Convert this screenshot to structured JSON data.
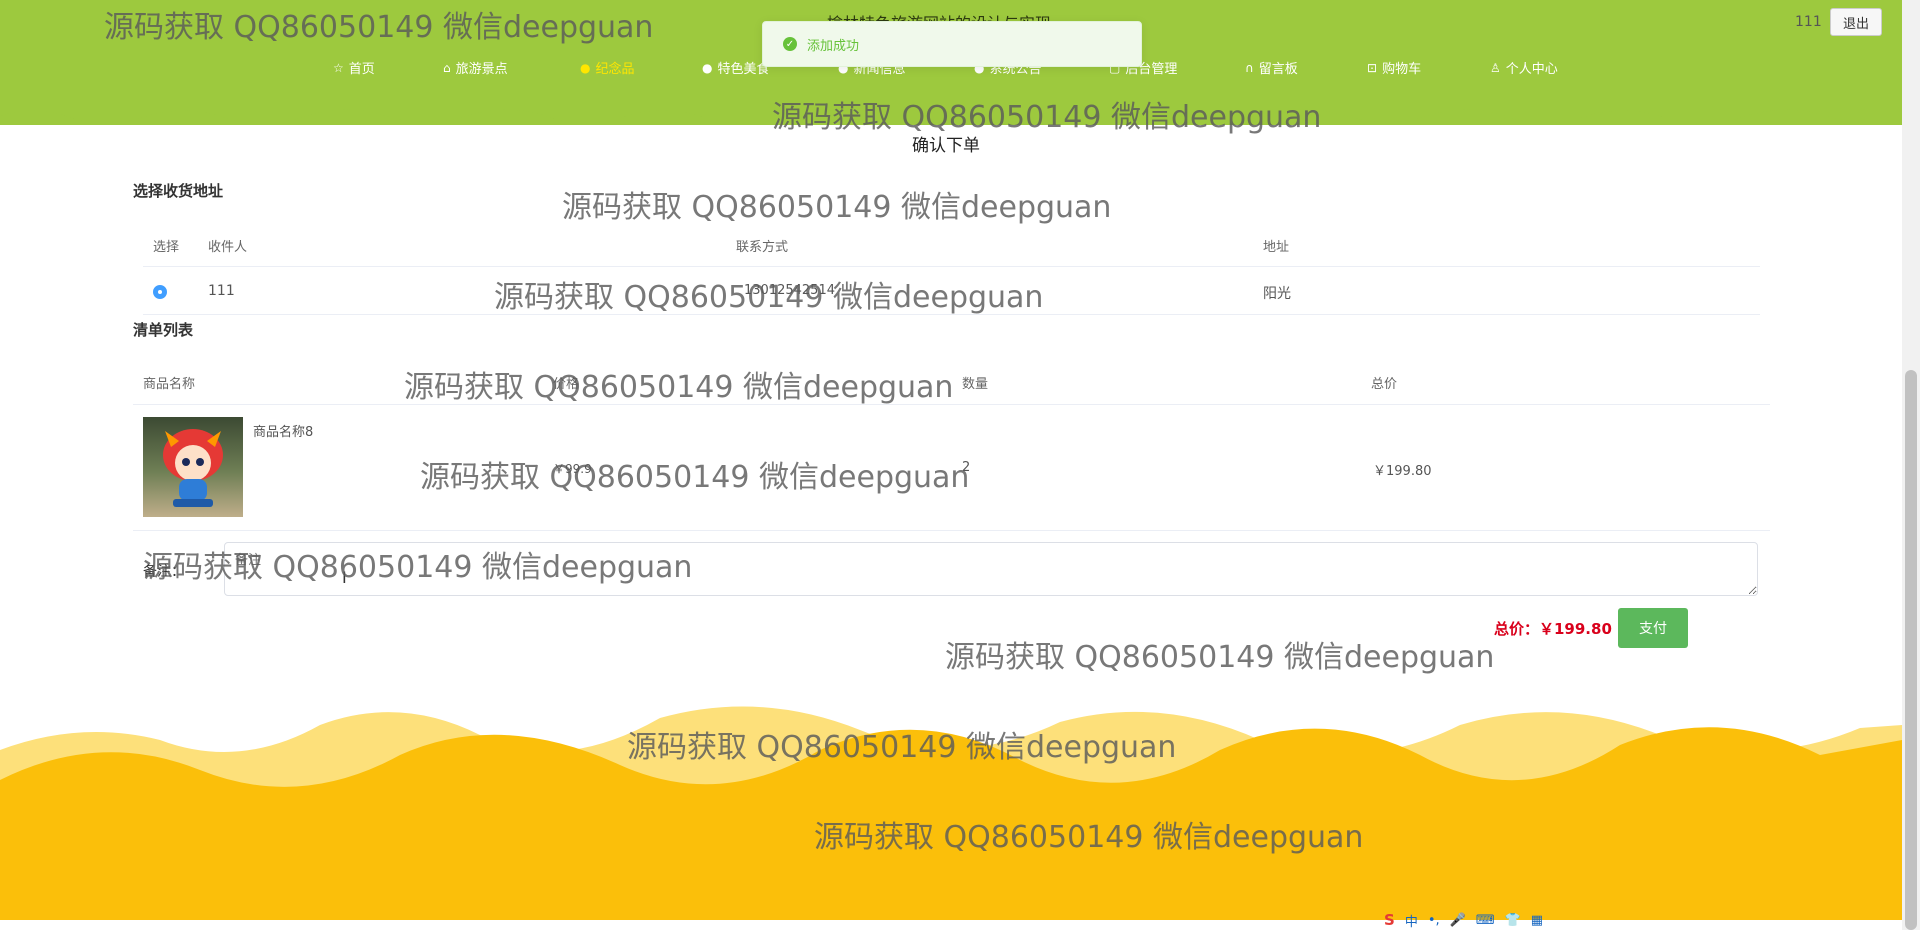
{
  "header": {
    "site_title": "榆林特色旅游网站的设计与实现",
    "user_name": "111",
    "logout_label": "退出",
    "nav": [
      {
        "label": "首页",
        "icon": "star-icon",
        "active": false
      },
      {
        "label": "旅游景点",
        "icon": "bag-icon",
        "active": false
      },
      {
        "label": "纪念品",
        "icon": "info-icon",
        "active": true
      },
      {
        "label": "特色美食",
        "icon": "question-icon",
        "active": false
      },
      {
        "label": "新闻信息",
        "icon": "info-icon",
        "active": false
      },
      {
        "label": "系统公告",
        "icon": "question-icon",
        "active": false
      },
      {
        "label": "后台管理",
        "icon": "window-icon",
        "active": false
      },
      {
        "label": "留言板",
        "icon": "headset-icon",
        "active": false
      },
      {
        "label": "购物车",
        "icon": "cart-icon",
        "active": false
      },
      {
        "label": "个人中心",
        "icon": "user-icon",
        "active": false
      }
    ]
  },
  "toast": {
    "message": "添加成功",
    "color": "#67c23a"
  },
  "page_title": "确认下单",
  "address": {
    "section_label": "选择收货地址",
    "columns": [
      "选择",
      "收件人",
      "联系方式",
      "地址"
    ],
    "rows": [
      {
        "recipient": "111",
        "phone": "13012542514",
        "address": "阳光",
        "selected": true
      }
    ]
  },
  "items": {
    "section_label": "清单列表",
    "columns": [
      "商品名称",
      "价格",
      "数量",
      "总价"
    ],
    "rows": [
      {
        "name": "商品名称8",
        "price": "￥99.9",
        "quantity": "2",
        "total": "￥199.80"
      }
    ]
  },
  "remark": {
    "label": "备注：",
    "placeholder": "备注"
  },
  "order_total": {
    "label": "总价：￥199.80"
  },
  "pay_label": "支付",
  "watermark_text": "源码获取 QQ86050149 微信deepguan",
  "ime": {
    "items": [
      "S",
      "中",
      "•,",
      "🎤",
      "⌨",
      "👕",
      "▦"
    ]
  },
  "colors": {
    "header_green": "#9dc93e",
    "footer_yellow": "#fbbf0a",
    "active_nav": "#ffe600",
    "price_red": "#d9001b",
    "pay_green": "#5cb85c"
  }
}
